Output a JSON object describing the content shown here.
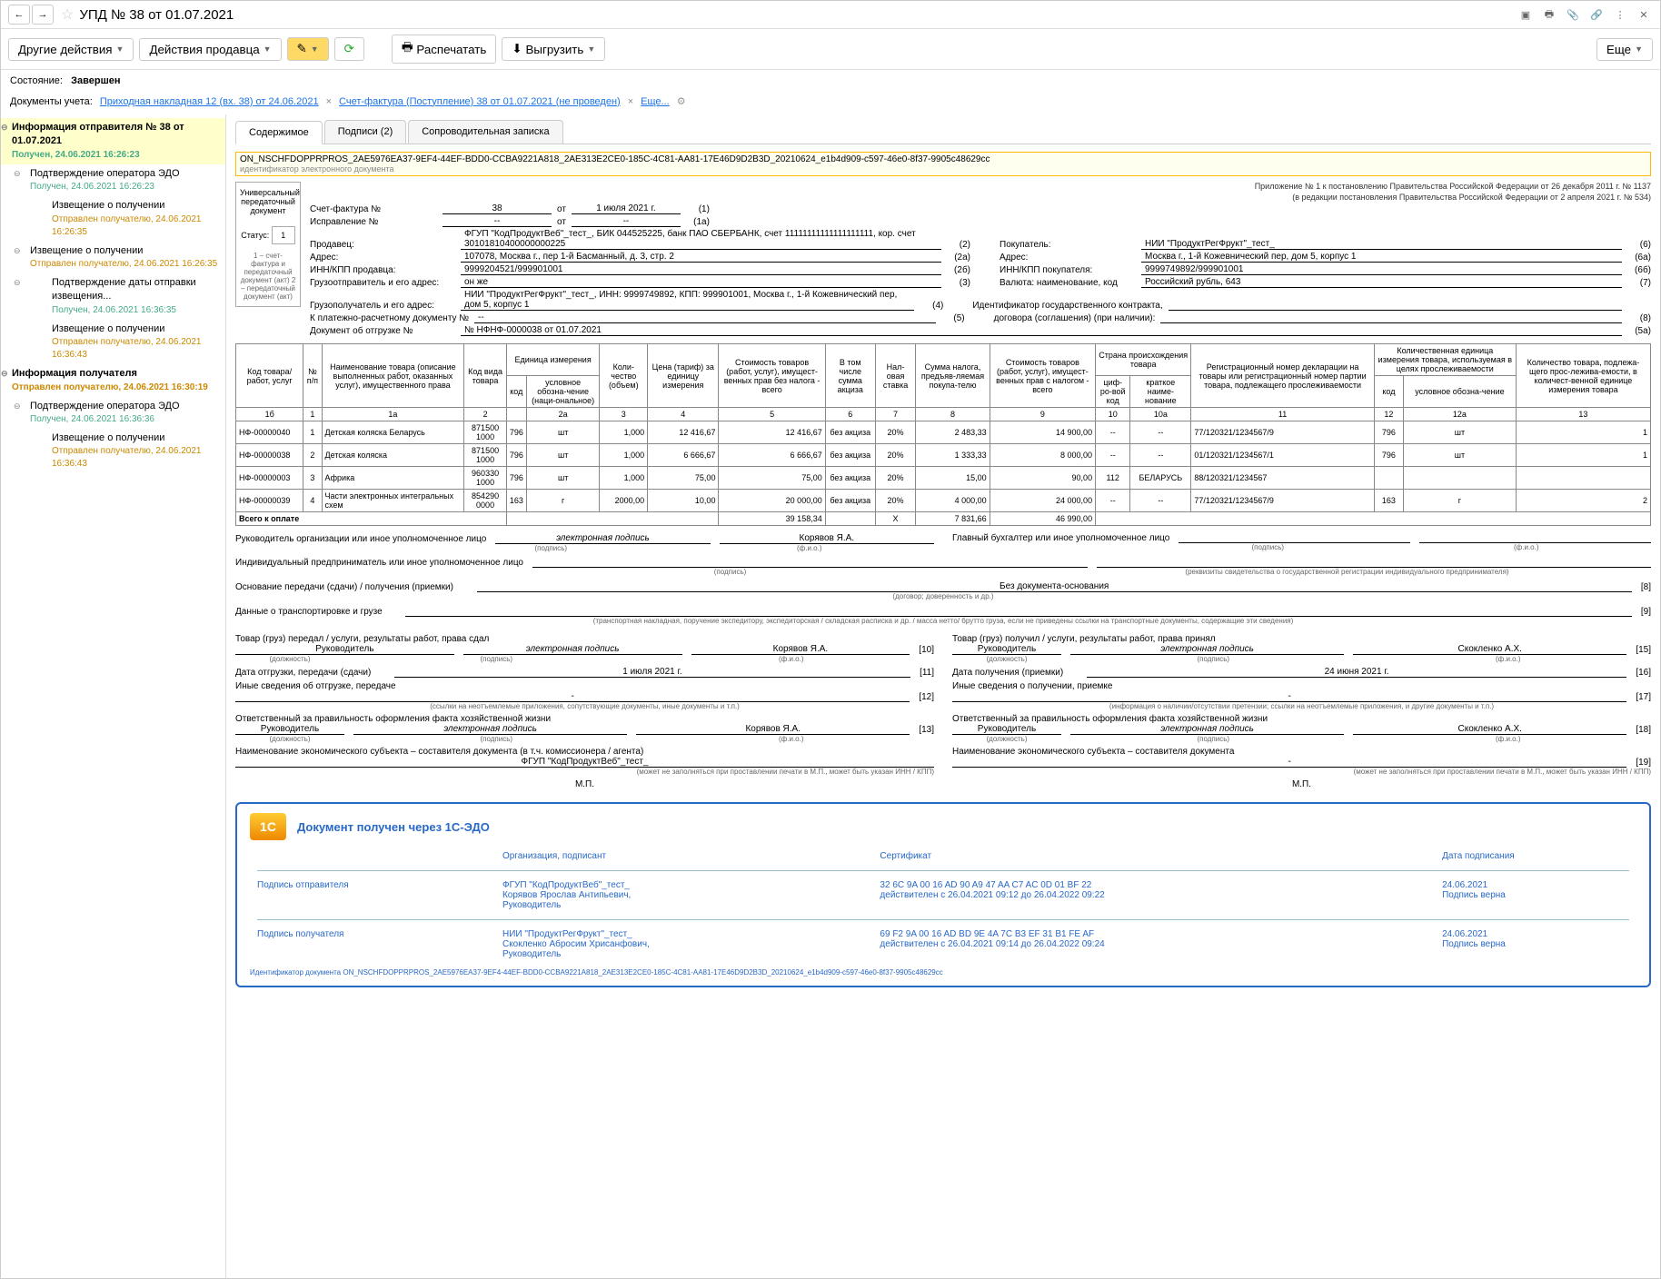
{
  "title": "УПД № 38 от 01.07.2021",
  "toolbar": {
    "other_actions": "Другие действия",
    "seller_actions": "Действия продавца",
    "print": "Распечатать",
    "export": "Выгрузить",
    "more": "Еще"
  },
  "status": {
    "label": "Состояние:",
    "value": "Завершен"
  },
  "doc_refs": {
    "label": "Документы учета:",
    "link1": "Приходная накладная 12 (вх. 38) от 24.06.2021",
    "link2": "Счет-фактура (Поступление) 38 от 01.07.2021 (не проведен)",
    "more": "Еще..."
  },
  "sidebar": {
    "root": "Информация отправителя № 38 от 01.07.2021",
    "root_sub": "Получен, 24.06.2021 16:26:23",
    "items": [
      {
        "label": "Подтверждение оператора ЭДО",
        "sub": "Получен, 24.06.2021 16:26:23",
        "sub_cls": "green",
        "level": 1,
        "exp": true
      },
      {
        "label": "Извещение о получении",
        "sub": "Отправлен получателю, 24.06.2021 16:26:35",
        "sub_cls": "orange",
        "level": 2
      },
      {
        "label": "Извещение о получении",
        "sub": "Отправлен получателю, 24.06.2021 16:26:35",
        "sub_cls": "orange",
        "level": 1,
        "exp": true
      },
      {
        "label": "Подтверждение даты отправки извещения...",
        "sub": "Получен, 24.06.2021 16:36:35",
        "sub_cls": "green",
        "level": 2,
        "exp": true
      },
      {
        "label": "Извещение о получении",
        "sub": "Отправлен получателю, 24.06.2021 16:36:43",
        "sub_cls": "orange",
        "level": 2
      },
      {
        "label": "Информация получателя",
        "sub": "Отправлен получателю, 24.06.2021 16:30:19",
        "sub_cls": "orange",
        "level": 0,
        "exp": true
      },
      {
        "label": "Подтверждение оператора ЭДО",
        "sub": "Получен, 24.06.2021 16:36:36",
        "sub_cls": "green",
        "level": 1,
        "exp": true
      },
      {
        "label": "Извещение о получении",
        "sub": "Отправлен получателю, 24.06.2021 16:36:43",
        "sub_cls": "orange",
        "level": 2
      }
    ]
  },
  "tabs": {
    "t1": "Содержимое",
    "t2": "Подписи (2)",
    "t3": "Сопроводительная записка"
  },
  "doc_id": "ON_NSCHFDOPPRPROS_2AE5976EA37-9EF4-44EF-BDD0-CCBA9221A818_2AE313E2CE0-185C-4C81-AA81-17E46D9D2B3D_20210624_e1b4d909-c597-46e0-8f37-9905c48629cc",
  "doc_id_label": "идентификатор электронного документа",
  "doc_left": {
    "name": "Универсальный передаточный документ",
    "status_label": "Статус:",
    "status": "1",
    "note": "1 – счет-фактура и передаточный документ (акт) 2 – передаточный документ (акт)"
  },
  "invoice": {
    "l_invoice": "Счет-фактура №",
    "num": "38",
    "l_ot": "от",
    "date": "1 июля 2021 г.",
    "n1": "(1)",
    "l_corr": "Исправление №",
    "corr": "--",
    "corr_date": "--",
    "n1a": "(1a)",
    "note1": "Приложение № 1 к постановлению Правительства Российской Федерации от 26 декабря 2011 г. № 1137",
    "note2": "(в редакции постановления Правительства Российской Федерации от 2 апреля 2021 г. № 534)",
    "rows": [
      {
        "label": "Продавец:",
        "value": "ФГУП \"КодПродуктВеб\"_тест_, БИК 044525225, банк ПАО СБЕРБАНК, счет 11111111111111111111, кор. счет 30101810400000000225",
        "n": "(2)",
        "label2": "Покупатель:",
        "value2": "НИИ \"ПродуктРегФрукт\"_тест_",
        "n2": "(6)"
      },
      {
        "label": "Адрес:",
        "value": "107078, Москва г., пер 1-й Басманный, д. 3, стр. 2",
        "n": "(2а)",
        "label2": "Адрес:",
        "value2": "Москва г., 1-й Кожевнический пер, дом 5, корпус 1",
        "n2": "(6а)"
      },
      {
        "label": "ИНН/КПП продавца:",
        "value": "9999204521/999901001",
        "n": "(2б)",
        "label2": "ИНН/КПП покупателя:",
        "value2": "9999749892/999901001",
        "n2": "(6б)"
      },
      {
        "label": "Грузоотправитель и его адрес:",
        "value": "он же",
        "n": "(3)",
        "label2": "Валюта: наименование, код",
        "value2": "Российский рубль, 643",
        "n2": "(7)"
      },
      {
        "label": "Грузополучатель и его адрес:",
        "value": "НИИ \"ПродуктРегФрукт\"_тест_, ИНН: 9999749892, КПП: 999901001, Москва г., 1-й Кожевнический пер, дом 5, корпус 1",
        "n": "(4)",
        "label2": "Идентификатор государственного контракта,",
        "value2": "",
        "n2": ""
      },
      {
        "label": "К платежно-расчетному документу №",
        "value": "--",
        "n": "(5)",
        "label2": "договора (соглашения) (при наличии):",
        "value2": "",
        "n2": "(8)"
      },
      {
        "label": "Документ об отгрузке №",
        "value": "№ НФНФ-0000038 от 01.07.2021",
        "n": "(5а)",
        "label2": "",
        "value2": "",
        "n2": ""
      }
    ]
  },
  "table": {
    "headers": {
      "code": "Код товара/ работ, услуг",
      "np": "№ п/п",
      "name": "Наименование товара (описание выполненных работ, оказанных услуг), имущественного права",
      "kind": "Код вида товара",
      "unit": "Единица измерения",
      "unit_code": "код",
      "unit_name": "условное обозна-чение (наци-ональное)",
      "qty": "Коли-чество (объем)",
      "price": "Цена (тариф) за единицу измерения",
      "cost": "Стоимость товаров (работ, услуг), имущест-венных прав без налога - всего",
      "excise": "В том числе сумма акциза",
      "rate": "Нал-овая ставка",
      "tax": "Сумма налога, предъяв-ляемая покупа-телю",
      "total": "Стоимость товаров (работ, услуг), имущест-венных прав с налогом - всего",
      "country": "Страна происхождения товара",
      "c_code": "циф-ро-вой код",
      "c_name": "краткое наиме-нование",
      "reg": "Регистрационный номер декларации на товары или регистрационный номер партии товара, подлежащего прослеживаемости",
      "trace_unit": "Количественная единица измерения товара, используемая в целях прослеживаемости",
      "trace_code": "код",
      "trace_name": "условное обозна-чение",
      "trace_qty": "Количество товара, подлежа-щего прос-лежива-емости, в количест-венной единице измерения товара",
      "nums": [
        "1б",
        "1",
        "1а",
        "2",
        "2а",
        "3",
        "4",
        "5",
        "6",
        "7",
        "8",
        "9",
        "10",
        "10а",
        "11",
        "12",
        "12а",
        "13"
      ]
    },
    "rows": [
      {
        "code": "НФ-00000040",
        "np": "1",
        "name": "Детская коляска Беларусь",
        "kind": "871500 1000",
        "uc": "796",
        "un": "шт",
        "qty": "1,000",
        "price": "12 416,67",
        "cost": "12 416,67",
        "excise": "без акциза",
        "rate": "20%",
        "tax": "2 483,33",
        "total": "14 900,00",
        "cc": "--",
        "cn": "--",
        "reg": "77/120321/1234567/9",
        "tc": "796",
        "tn": "шт",
        "tq": "1"
      },
      {
        "code": "НФ-00000038",
        "np": "2",
        "name": "Детская коляска",
        "kind": "871500 1000",
        "uc": "796",
        "un": "шт",
        "qty": "1,000",
        "price": "6 666,67",
        "cost": "6 666,67",
        "excise": "без акциза",
        "rate": "20%",
        "tax": "1 333,33",
        "total": "8 000,00",
        "cc": "--",
        "cn": "--",
        "reg": "01/120321/1234567/1",
        "tc": "796",
        "tn": "шт",
        "tq": "1"
      },
      {
        "code": "НФ-00000003",
        "np": "3",
        "name": "Африка",
        "kind": "960330 1000",
        "uc": "796",
        "un": "шт",
        "qty": "1,000",
        "price": "75,00",
        "cost": "75,00",
        "excise": "без акциза",
        "rate": "20%",
        "tax": "15,00",
        "total": "90,00",
        "cc": "112",
        "cn": "БЕЛАРУСЬ",
        "reg": "88/120321/1234567",
        "tc": "",
        "tn": "",
        "tq": ""
      },
      {
        "code": "НФ-00000039",
        "np": "4",
        "name": "Части электронных интегральных схем",
        "kind": "854290 0000",
        "uc": "163",
        "un": "г",
        "qty": "2000,00",
        "price": "10,00",
        "cost": "20 000,00",
        "excise": "без акциза",
        "rate": "20%",
        "tax": "4 000,00",
        "total": "24 000,00",
        "cc": "--",
        "cn": "--",
        "reg": "77/120321/1234567/9",
        "tc": "163",
        "tn": "г",
        "tq": "2"
      }
    ],
    "footer": {
      "label": "Всего к оплате",
      "cost": "39 158,34",
      "x": "X",
      "tax": "7 831,66",
      "total": "46 990,00"
    }
  },
  "sig": {
    "head_left": "Руководитель организации или иное уполномоченное лицо",
    "e_sig": "электронная подпись",
    "sub_sig": "(подпись)",
    "fio": "Корявов Я.А.",
    "sub_fio": "(ф.и.о.)",
    "head_right": "Главный бухгалтер или иное уполномоченное лицо",
    "ip": "Индивидуальный предприниматель или иное уполномоченное лицо",
    "ip_note": "(реквизиты свидетельства о государственной регистрации индивидуального предпринимателя)",
    "basis_label": "Основание передачи (сдачи) / получения (приемки)",
    "basis": "Без документа-основания",
    "basis_sub": "(договор; доверенность и др.)",
    "basis_n": "[8]",
    "transport_label": "Данные о транспортировке и грузе",
    "transport_n": "[9]",
    "transport_sub": "(транспортная накладная, поручение экспедитору, экспедиторская / складская расписка и др. / масса нетто/ брутто груза, если не приведены ссылки на транспортные документы, содержащие эти сведения)",
    "left": {
      "head": "Товар (груз) передал / услуги, результаты работ, права сдал",
      "role": "Руководитель",
      "role_sub": "(должность)",
      "name": "Корявов Я.А.",
      "n": "[10]",
      "date_label": "Дата отгрузки, передачи (сдачи)",
      "date": "1 июля 2021 г.",
      "dn": "[11]",
      "other": "Иные сведения об отгрузке, передаче",
      "other_sub": "(ссылки на неотъемлемые приложения, сопутствующие документы, иные документы и т.п.)",
      "on": "[12]",
      "resp": "Ответственный за правильность оформления факта хозяйственной жизни",
      "resp_role": "Руководитель",
      "resp_name": "Корявов Я.А.",
      "rn": "[13]",
      "org_label": "Наименование экономического субъекта – составителя документа (в т.ч. комиссионера / агента)",
      "org": "ФГУП \"КодПродуктВеб\"_тест_",
      "org_sub": "(может не заполняться при проставлении печати в М.П., может быть указан ИНН / КПП)",
      "mp": "М.П."
    },
    "right": {
      "head": "Товар (груз) получил / услуги, результаты работ, права принял",
      "role": "Руководитель",
      "name": "Скокленко А.Х.",
      "n": "[15]",
      "date_label": "Дата получения (приемки)",
      "date": "24 июня 2021 г.",
      "dn": "[16]",
      "other": "Иные сведения о получении, приемке",
      "other_sub": "(информация о наличии/отсутствии претензии; ссылки на неотъемлемые приложения, и другие документы и т.п.)",
      "on": "[17]",
      "resp": "Ответственный за правильность оформления факта хозяйственной жизни",
      "resp_role": "Руководитель",
      "resp_name": "Скокленко А.Х.",
      "rn": "[18]",
      "org_label": "Наименование экономического субъекта – составителя документа",
      "org": "-",
      "org_sub": "(может не заполняться при проставлении печати в М.П., может быть указан ИНН / КПП)",
      "orn": "[19]",
      "mp": "М.П."
    }
  },
  "edo": {
    "title": "Документ получен через 1С-ЭДО",
    "h_org": "Организация, подписант",
    "h_cert": "Сертификат",
    "h_date": "Дата подписания",
    "s1_label": "Подпись отправителя",
    "s1_org": "ФГУП \"КодПродуктВеб\"_тест_\nКорявов Ярослав Антипьевич,\nРуководитель",
    "s1_cert": "32 6C 9A 00 16 AD 90 A9 47 AA C7 AC 0D 01 BF 22\nдействителен с 26.04.2021 09:12 до 26.04.2022 09:22",
    "s1_date": "24.06.2021\nПодпись верна",
    "s2_label": "Подпись получателя",
    "s2_org": "НИИ \"ПродуктРегФрукт\"_тест_\nСкокленко Абросим Хрисанфович,\nРуководитель",
    "s2_cert": "69 F2 9A 00 16 AD BD 9E 4A 7C B3 EF 31 B1 FE AF\nдействителен с 26.04.2021 09:14 до 26.04.2022 09:24",
    "s2_date": "24.06.2021\nПодпись верна",
    "foot": "Идентификатор документа ON_NSCHFDOPPRPROS_2AE5976EA37-9EF4-44EF-BDD0-CCBA9221A818_2AE313E2CE0-185C-4C81-AA81-17E46D9D2B3D_20210624_e1b4d909-c597-46e0-8f37-9905c48629cc"
  }
}
